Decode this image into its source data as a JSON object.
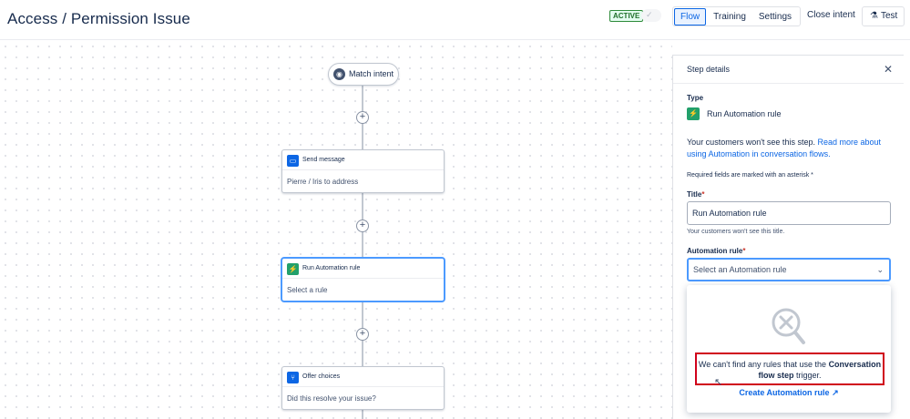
{
  "header": {
    "title": "Access / Permission Issue",
    "status_badge": "ACTIVE",
    "tabs": [
      {
        "label": "Flow",
        "active": true
      },
      {
        "label": "Training",
        "active": false
      },
      {
        "label": "Settings",
        "active": false
      }
    ],
    "close_intent_label": "Close intent",
    "test_label": "Test"
  },
  "flow": {
    "start_label": "Match intent",
    "nodes": [
      {
        "title": "Send message",
        "body": "Pierre / Iris to address",
        "icon": "message-icon",
        "selected": false
      },
      {
        "title": "Run Automation rule",
        "body": "Select a rule",
        "icon": "automation-icon",
        "selected": true
      },
      {
        "title": "Offer choices",
        "body": "Did this resolve your issue?",
        "icon": "branch-icon",
        "selected": false
      }
    ]
  },
  "panel": {
    "title": "Step details",
    "type_label": "Type",
    "type_name": "Run Automation rule",
    "desc_text": "Your customers won't see this step. ",
    "desc_link": "Read more about using Automation in conversation flows.",
    "required_note": "Required fields are marked with an asterisk *",
    "title_label": "Title",
    "title_value": "Run Automation rule",
    "title_helper": "Your customers won't see this title.",
    "rule_label": "Automation rule",
    "rule_placeholder": "Select an Automation rule",
    "empty_msg_1": "We can't find any rules that use the ",
    "empty_msg_bold": "Conversation flow step",
    "empty_msg_2": " trigger.",
    "create_link": "Create Automation rule"
  }
}
